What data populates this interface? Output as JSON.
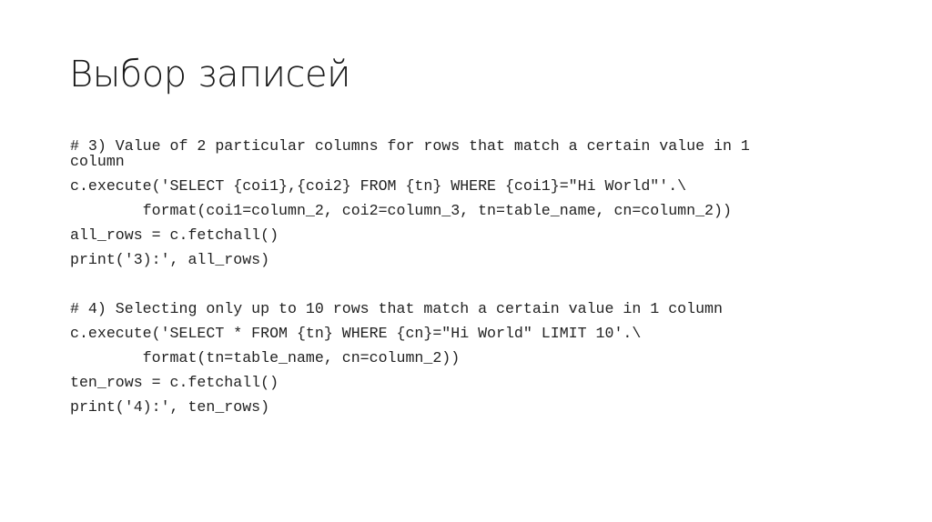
{
  "slide": {
    "title": "Выбор записей",
    "code_lines": [
      {
        "text": "# 3) Value of 2 particular columns for rows that match a certain value in 1"
      },
      {
        "text": "column"
      },
      {
        "text": "c.execute('SELECT {coi1},{coi2} FROM {tn} WHERE {coi1}=\"Hi World\"'.\\"
      },
      {
        "text": "        format(coi1=column_2, coi2=column_3, tn=table_name, cn=column_2))"
      },
      {
        "text": "all_rows = c.fetchall()"
      },
      {
        "text": "print('3):', all_rows)"
      },
      {
        "text": ""
      },
      {
        "text": "# 4) Selecting only up to 10 rows that match a certain value in 1 column"
      },
      {
        "text": "c.execute('SELECT * FROM {tn} WHERE {cn}=\"Hi World\" LIMIT 10'.\\"
      },
      {
        "text": "        format(tn=table_name, cn=column_2))"
      },
      {
        "text": "ten_rows = c.fetchall()"
      },
      {
        "text": "print('4):', ten_rows)"
      }
    ]
  }
}
